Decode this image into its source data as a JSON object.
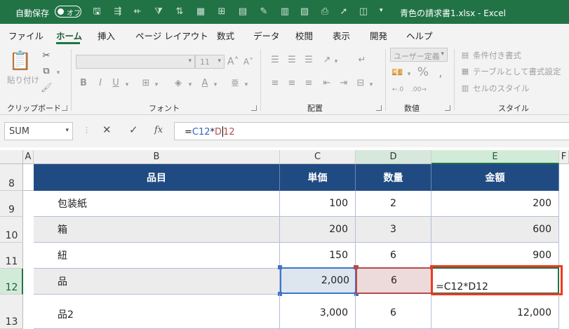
{
  "titlebar": {
    "autosave_label": "自動保存",
    "autosave_state": "オフ",
    "document_title": "青色の請求書1.xlsx  -  Excel"
  },
  "ribbon_tabs": [
    {
      "label": "ファイル",
      "active": false
    },
    {
      "label": "ホーム",
      "active": true
    },
    {
      "label": "挿入",
      "active": false
    },
    {
      "label": "ページ レイアウト",
      "active": false
    },
    {
      "label": "数式",
      "active": false
    },
    {
      "label": "データ",
      "active": false
    },
    {
      "label": "校閲",
      "active": false
    },
    {
      "label": "表示",
      "active": false
    },
    {
      "label": "開発",
      "active": false
    },
    {
      "label": "ヘルプ",
      "active": false
    }
  ],
  "ribbon": {
    "clipboard": {
      "paste_label": "貼り付け",
      "group_label": "クリップボード"
    },
    "font": {
      "font_size": "11",
      "bold": "B",
      "italic": "I",
      "underline": "U",
      "group_label": "フォント"
    },
    "alignment": {
      "group_label": "配置"
    },
    "number": {
      "format_value": "ユーザー定義",
      "percent": "%",
      "group_label": "数値"
    },
    "styles": {
      "conditional": "条件付き書式",
      "table_format": "テーブルとして書式設定",
      "cell_styles": "セルのスタイル",
      "group_label": "スタイル"
    }
  },
  "formula_bar": {
    "name_box": "SUM",
    "cancel": "✕",
    "enter": "✓",
    "fx": "fx",
    "formula_prefix": "=",
    "ref1": "C12",
    "operator": "*",
    "ref2_a": "D",
    "ref2_b": "12"
  },
  "sheet": {
    "columns": [
      "A",
      "B",
      "C",
      "D",
      "E",
      "F"
    ],
    "header": {
      "row": "8",
      "item": "品目",
      "unit_price": "単価",
      "qty": "数量",
      "amount": "金額"
    },
    "rows": [
      {
        "row": "9",
        "item": "包装紙",
        "unit_price": "100",
        "qty": "2",
        "amount": "200"
      },
      {
        "row": "10",
        "item": "箱",
        "unit_price": "200",
        "qty": "3",
        "amount": "600"
      },
      {
        "row": "11",
        "item": "紐",
        "unit_price": "150",
        "qty": "6",
        "amount": "900"
      },
      {
        "row": "12",
        "item": "品",
        "unit_price": "2,000",
        "qty": "6",
        "amount": "=C12*D12"
      },
      {
        "row": "13",
        "item": "品2",
        "unit_price": "3,000",
        "qty": "6",
        "amount": "12,000"
      }
    ],
    "selected_column": "E",
    "selected_row": "12"
  },
  "colors": {
    "excel_green": "#217346",
    "table_header": "#1f4b82",
    "ref_blue": "#3e74c9",
    "ref_red": "#b84a4a",
    "highlight": "#ee3a1e"
  }
}
